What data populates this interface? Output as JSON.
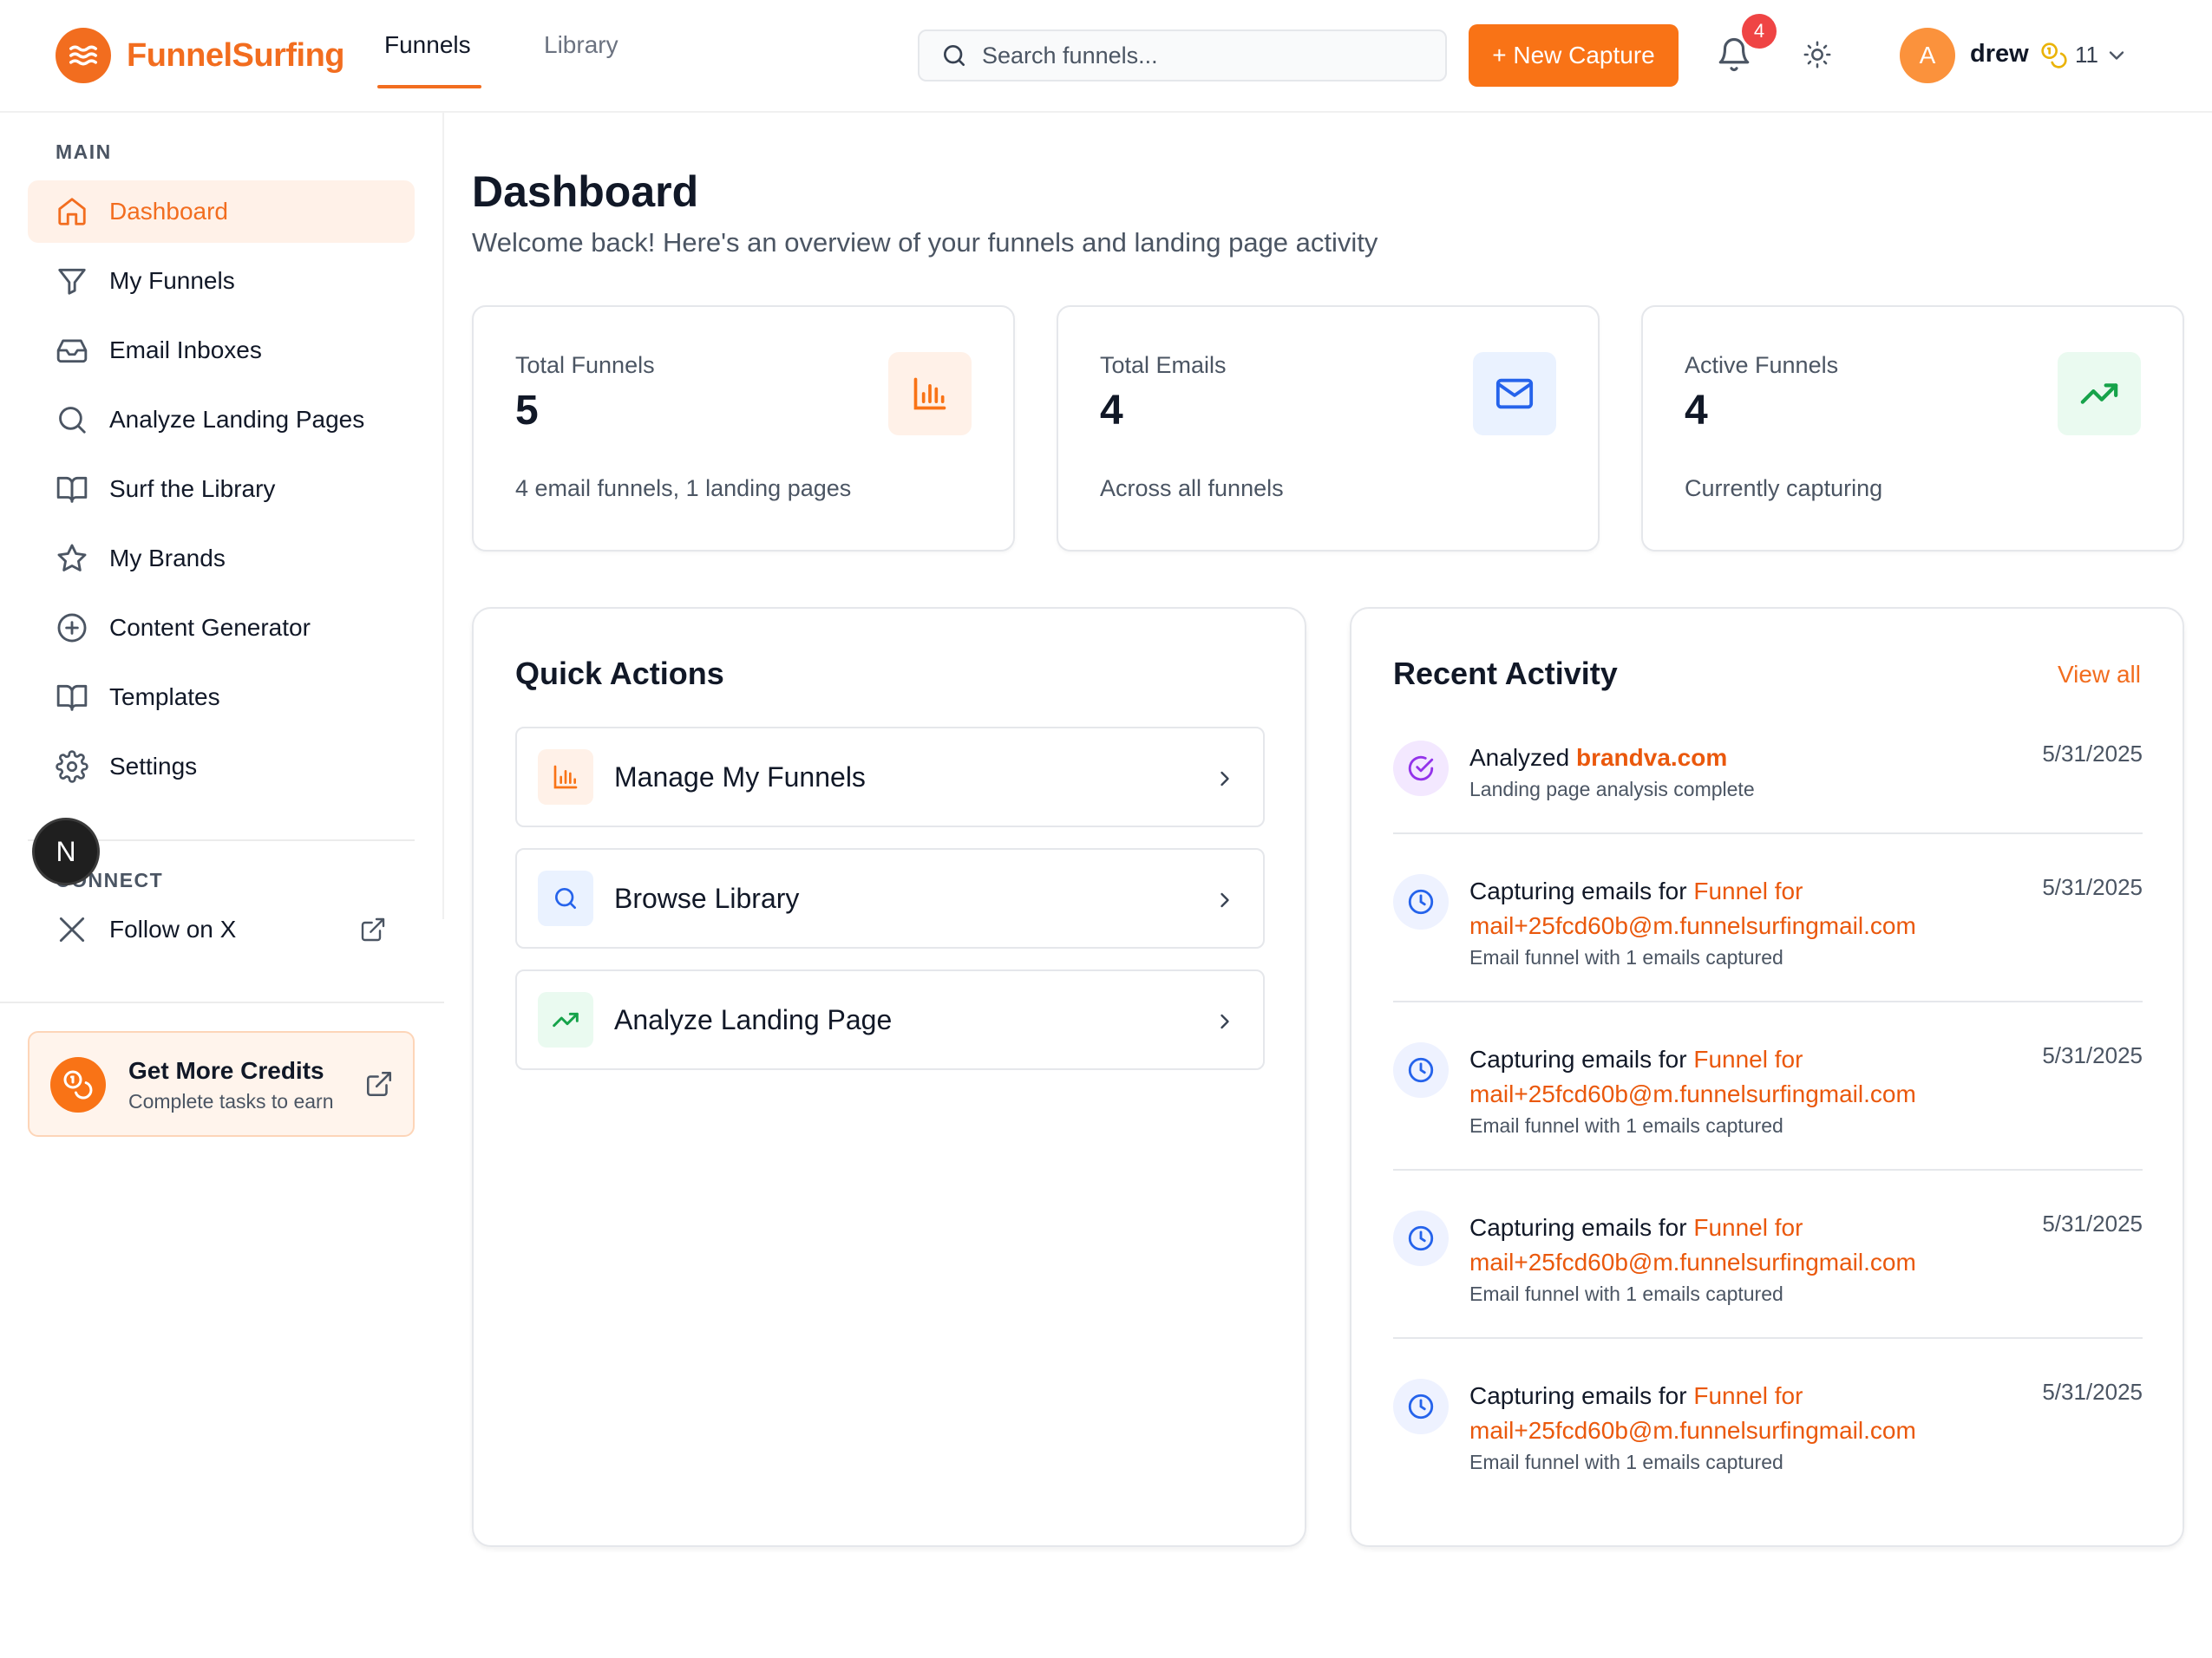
{
  "brand": {
    "name": "FunnelSurfing",
    "accent": "#f26d1f"
  },
  "topnav": {
    "tabs": [
      {
        "label": "Funnels",
        "active": true
      },
      {
        "label": "Library",
        "active": false
      }
    ]
  },
  "search": {
    "placeholder": "Search funnels..."
  },
  "header": {
    "new_capture_label": "+ New Capture",
    "notifications_count": "4",
    "user": {
      "initial": "A",
      "name": "drew",
      "credits": "11"
    }
  },
  "sidebar": {
    "main_label": "MAIN",
    "items": [
      {
        "label": "Dashboard",
        "icon": "home-icon",
        "active": true
      },
      {
        "label": "My Funnels",
        "icon": "funnel-icon"
      },
      {
        "label": "Email Inboxes",
        "icon": "inbox-icon"
      },
      {
        "label": "Analyze Landing Pages",
        "icon": "search-icon"
      },
      {
        "label": "Surf the Library",
        "icon": "book-icon"
      },
      {
        "label": "My Brands",
        "icon": "star-icon"
      },
      {
        "label": "Content Generator",
        "icon": "plus-circle-icon"
      },
      {
        "label": "Templates",
        "icon": "book-open-icon"
      },
      {
        "label": "Settings",
        "icon": "gear-icon"
      }
    ],
    "connect_label": "CONNECT",
    "connect_items": [
      {
        "label": "Follow on X",
        "icon": "x-logo-icon"
      }
    ],
    "credits_card": {
      "title": "Get More Credits",
      "subtitle": "Complete tasks to earn"
    },
    "dev_badge": "N"
  },
  "main": {
    "title": "Dashboard",
    "subtitle": "Welcome back! Here's an overview of your funnels and landing page activity",
    "stats": [
      {
        "label": "Total Funnels",
        "value": "5",
        "note": "4 email funnels, 1 landing pages",
        "icon": "bar-chart-icon",
        "color": "#f97316",
        "bg": "#fff1e8"
      },
      {
        "label": "Total Emails",
        "value": "4",
        "note": "Across all funnels",
        "icon": "mail-icon",
        "color": "#2563eb",
        "bg": "#eaf2ff"
      },
      {
        "label": "Active Funnels",
        "value": "4",
        "note": "Currently capturing",
        "icon": "trending-up-icon",
        "color": "#16a34a",
        "bg": "#eafaf0"
      }
    ],
    "quick_actions": {
      "title": "Quick Actions",
      "items": [
        {
          "label": "Manage My Funnels",
          "icon": "bar-chart-icon"
        },
        {
          "label": "Browse Library",
          "icon": "search-icon"
        },
        {
          "label": "Analyze Landing Page",
          "icon": "trending-up-icon"
        }
      ]
    },
    "recent_activity": {
      "title": "Recent Activity",
      "view_all": "View all",
      "items": [
        {
          "prefix": "Analyzed ",
          "link1": "brandva.com",
          "link2": "",
          "sub": "Landing page analysis complete",
          "date": "5/31/2025",
          "icon": "check-circle-icon"
        },
        {
          "prefix": "Capturing emails for ",
          "link1": "Funnel for",
          "link2": "mail+25fcd60b@m.funnelsurfingmail.com",
          "sub": "Email funnel with 1 emails captured",
          "date": "5/31/2025",
          "icon": "clock-icon"
        },
        {
          "prefix": "Capturing emails for ",
          "link1": "Funnel for",
          "link2": "mail+25fcd60b@m.funnelsurfingmail.com",
          "sub": "Email funnel with 1 emails captured",
          "date": "5/31/2025",
          "icon": "clock-icon"
        },
        {
          "prefix": "Capturing emails for ",
          "link1": "Funnel for",
          "link2": "mail+25fcd60b@m.funnelsurfingmail.com",
          "sub": "Email funnel with 1 emails captured",
          "date": "5/31/2025",
          "icon": "clock-icon"
        },
        {
          "prefix": "Capturing emails for ",
          "link1": "Funnel for",
          "link2": "mail+25fcd60b@m.funnelsurfingmail.com",
          "sub": "Email funnel with 1 emails captured",
          "date": "5/31/2025",
          "icon": "clock-icon"
        }
      ]
    }
  }
}
